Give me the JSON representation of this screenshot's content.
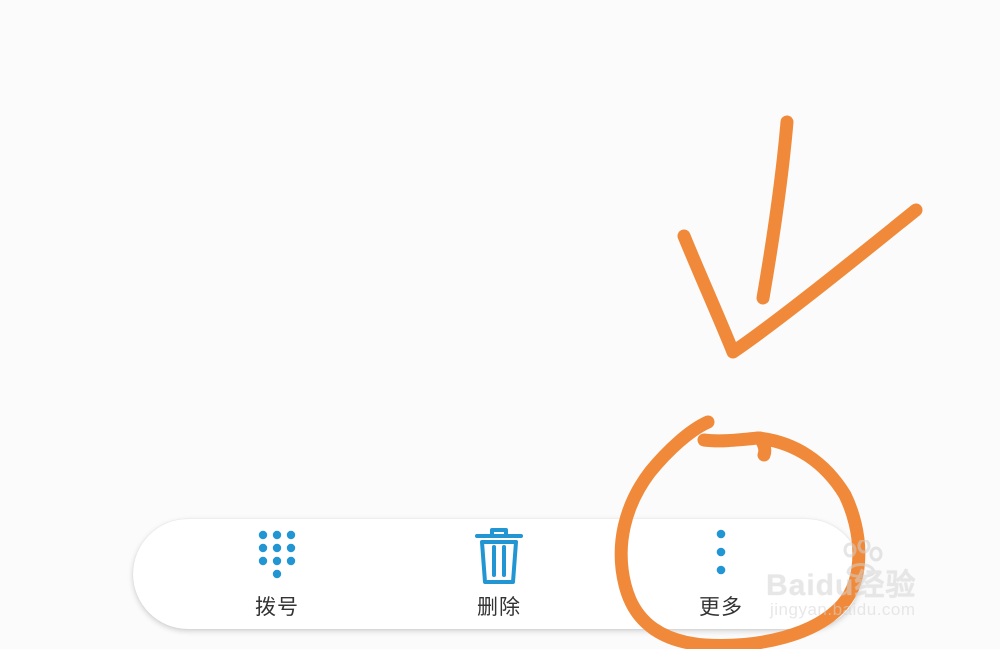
{
  "toolbar": {
    "actions": [
      {
        "id": "dial",
        "label": "拨号",
        "icon": "dialpad-icon"
      },
      {
        "id": "delete",
        "label": "删除",
        "icon": "trash-icon"
      },
      {
        "id": "more",
        "label": "更多",
        "icon": "more-vertical-icon"
      }
    ]
  },
  "annotation": {
    "color": "#f08a3a",
    "shapes": [
      "arrow-down-left",
      "circle-around-more"
    ]
  },
  "watermark": {
    "brand": "Baidu经验",
    "url": "jingyan.baidu.com"
  },
  "colors": {
    "background": "#fbfbfb",
    "accent": "#2196d3",
    "label": "#333333"
  }
}
